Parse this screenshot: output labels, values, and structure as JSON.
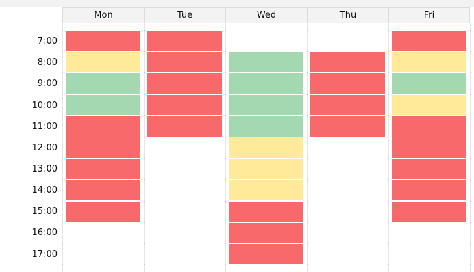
{
  "calendar": {
    "days": [
      "Mon",
      "Tue",
      "Wed",
      "Thu",
      "Fri"
    ],
    "hours": [
      "7:00",
      "8:00",
      "9:00",
      "10:00",
      "11:00",
      "12:00",
      "13:00",
      "14:00",
      "15:00",
      "16:00",
      "17:00"
    ],
    "status_colors": {
      "red": "#f7696b",
      "yellow": "#feea98",
      "green": "#a4d8b1"
    },
    "slots": {
      "Mon": [
        {
          "hour": "7:00",
          "status": "red"
        },
        {
          "hour": "8:00",
          "status": "yellow"
        },
        {
          "hour": "9:00",
          "status": "green"
        },
        {
          "hour": "10:00",
          "status": "green"
        },
        {
          "hour": "11:00",
          "status": "red"
        },
        {
          "hour": "12:00",
          "status": "red"
        },
        {
          "hour": "13:00",
          "status": "red"
        },
        {
          "hour": "14:00",
          "status": "red"
        },
        {
          "hour": "15:00",
          "status": "red"
        }
      ],
      "Tue": [
        {
          "hour": "7:00",
          "status": "red"
        },
        {
          "hour": "8:00",
          "status": "red"
        },
        {
          "hour": "9:00",
          "status": "red"
        },
        {
          "hour": "10:00",
          "status": "red"
        },
        {
          "hour": "11:00",
          "status": "red"
        }
      ],
      "Wed": [
        {
          "hour": "8:00",
          "status": "green"
        },
        {
          "hour": "9:00",
          "status": "green"
        },
        {
          "hour": "10:00",
          "status": "green"
        },
        {
          "hour": "11:00",
          "status": "green"
        },
        {
          "hour": "12:00",
          "status": "yellow"
        },
        {
          "hour": "13:00",
          "status": "yellow"
        },
        {
          "hour": "14:00",
          "status": "yellow"
        },
        {
          "hour": "15:00",
          "status": "red"
        },
        {
          "hour": "16:00",
          "status": "red"
        },
        {
          "hour": "17:00",
          "status": "red"
        }
      ],
      "Thu": [
        {
          "hour": "8:00",
          "status": "red"
        },
        {
          "hour": "9:00",
          "status": "red"
        },
        {
          "hour": "10:00",
          "status": "red"
        },
        {
          "hour": "11:00",
          "status": "red"
        }
      ],
      "Fri": [
        {
          "hour": "7:00",
          "status": "red"
        },
        {
          "hour": "8:00",
          "status": "yellow"
        },
        {
          "hour": "9:00",
          "status": "green"
        },
        {
          "hour": "10:00",
          "status": "yellow"
        },
        {
          "hour": "11:00",
          "status": "red"
        },
        {
          "hour": "12:00",
          "status": "red"
        },
        {
          "hour": "13:00",
          "status": "red"
        },
        {
          "hour": "14:00",
          "status": "red"
        },
        {
          "hour": "15:00",
          "status": "red"
        }
      ]
    }
  }
}
